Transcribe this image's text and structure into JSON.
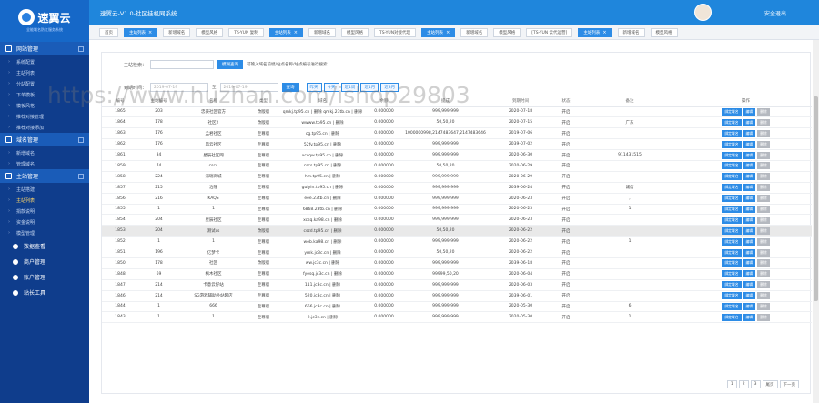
{
  "app": {
    "brand": "速翼云",
    "slogan": "全能域名防红服务系统",
    "title": "速翼云-V1.0-社区挂机网系统",
    "logout": "安全退出"
  },
  "sidebar": {
    "sections": [
      {
        "label": "网站管理",
        "items": [
          "系统配置",
          "主站列表",
          "分站配置",
          "下单模板",
          "模板风格",
          "推荐对接管理",
          "推荐对接添加"
        ]
      },
      {
        "label": "域名管理",
        "items": [
          "新增域名",
          "管理域名"
        ]
      },
      {
        "label": "主站管理",
        "items": [
          "主站搭建",
          "主站列表",
          "捐款说明",
          "资金说明",
          "模型管理"
        ],
        "active": "主站列表"
      }
    ],
    "plain": [
      "数据查看",
      "商户管理",
      "账户管理",
      "站长工具"
    ]
  },
  "tabs": [
    {
      "label": "首页"
    },
    {
      "label": "主站列表",
      "on": true
    },
    {
      "label": "新增域名"
    },
    {
      "label": "模型风格"
    },
    {
      "label": "TS-YUN 复制"
    },
    {
      "label": "主站列表",
      "on": true
    },
    {
      "label": "新增域名"
    },
    {
      "label": "模型风格"
    },
    {
      "label": "TS-YUN对接代理"
    },
    {
      "label": "主站列表",
      "on": true
    },
    {
      "label": "新增域名"
    },
    {
      "label": "模型风格"
    },
    {
      "label": "[TS-YUN 云代运营]"
    },
    {
      "label": "主站列表",
      "on": true
    },
    {
      "label": "新增域名"
    },
    {
      "label": "模型风格"
    }
  ],
  "filters": {
    "search_label": "主站检索：",
    "search_btn": "模糊查询",
    "hint": "可输入域名前缀/站点名称/站点编号进行搜索",
    "date_label": "到期时间：",
    "date_from": "2019-07-19",
    "to": "至",
    "date_to": "2019-07-19",
    "query_btn": "查询",
    "quick": [
      "昨天",
      "今天",
      "近1周",
      "近1月",
      "近3月"
    ]
  },
  "table": {
    "headers": [
      "编号",
      "主站编号",
      "名称",
      "类型",
      "域名",
      "余额",
      "提成",
      "到期时间",
      "状态",
      "备注",
      "操作"
    ],
    "actions": [
      "绑定域名",
      "编辑",
      "删除"
    ],
    "rows": [
      [
        "1865",
        "203",
        "忠豪社区官方",
        "改版版",
        "qmkj.tp95.cn | 删除 qmkj.23tb.cn | 删除",
        "0.000000",
        "999,999,999",
        "2020-07-18",
        "开启",
        ""
      ],
      [
        "1864",
        "178",
        "社区2",
        "改版版",
        "wwww.tp95.cn | 删除",
        "0.000000",
        "50,50,20",
        "2020-07-15",
        "开启",
        "广东"
      ],
      [
        "1863",
        "176",
        "孟君社区",
        "至尊版",
        "cg.tp95.cn | 删除",
        "0.000000",
        "1000000998,2147483647,2147483646",
        "2019-07-06",
        "开启",
        ""
      ],
      [
        "1862",
        "176",
        "风云社区",
        "至尊版",
        "52fy.tp95.cn | 删除",
        "0.000000",
        "999,999,999",
        "2039-07-02",
        "开启",
        ""
      ],
      [
        "1861",
        "34",
        "星辰社区网",
        "至尊版",
        "xcsqw.tp95.cn | 删除",
        "0.000000",
        "999,999,999",
        "2020-06-30",
        "开启",
        "911431515"
      ],
      [
        "1859",
        "74",
        "cscs",
        "至尊版",
        "cscs.tp95.cn | 删除",
        "0.000000",
        "50,50,20",
        "2020-06-29",
        "开启",
        ""
      ],
      [
        "1858",
        "224",
        "海瑞商城",
        "至尊版",
        "hm.tp95.cn | 删除",
        "0.000000",
        "999,999,999",
        "2020-06-29",
        "开启",
        ""
      ],
      [
        "1857",
        "215",
        "治隆",
        "至尊版",
        "guiyin.tp95.cn | 删除",
        "0.000000",
        "999,999,999",
        "2039-06-24",
        "开启",
        "诚信"
      ],
      [
        "1856",
        "216",
        "KAQS",
        "至尊版",
        "eee.23tb.cn | 删除",
        "0.000000",
        "999,999,999",
        "2020-06-23",
        "开启",
        ","
      ],
      [
        "1855",
        "1",
        "1",
        "至尊版",
        "6868.23tb.cn | 删除",
        "0.000000",
        "999,999,999",
        "2020-06-23",
        "开启",
        "1"
      ],
      [
        "1854",
        "204",
        "星辰社区",
        "至尊版",
        "xcsq.ka98.cn | 删除",
        "0.000000",
        "999,999,999",
        "2020-06-23",
        "开启",
        ""
      ],
      [
        "1853",
        "204",
        "测试cs",
        "改版版",
        "cszd.tp95.cn | 删除",
        "0.000000",
        "50,50,20",
        "2020-06-22",
        "开启",
        ""
      ],
      [
        "1852",
        "1",
        "1",
        "至尊版",
        "web.ka98.cn | 删除",
        "0.000000",
        "999,999,999",
        "2020-06-22",
        "开启",
        "1"
      ],
      [
        "1851",
        "196",
        "亿梦卡",
        "至尊版",
        "ymk.jc3c.cn | 删除",
        "0.000000",
        "50,50,20",
        "2020-06-22",
        "开启",
        ""
      ],
      [
        "1850",
        "178",
        "社区",
        "改版版",
        "ww.jc3c.cn | 删除",
        "0.000000",
        "999,999,999",
        "2039-06-18",
        "开启",
        ""
      ],
      [
        "1848",
        "69",
        "枫木社区",
        "至尊版",
        "fyesq.jc3c.cn | 删除",
        "0.000000",
        "99999,50,20",
        "2020-06-04",
        "开启",
        ""
      ],
      [
        "1847",
        "214",
        "卡意云好站",
        "至尊版",
        "111.jc3c.cn | 删除",
        "0.000000",
        "999,999,999",
        "2020-06-03",
        "开启",
        ""
      ],
      [
        "1846",
        "214",
        "SG游戏辅助外站网店",
        "至尊版",
        "520.jc3c.cn | 删除",
        "0.000000",
        "999,999,999",
        "2039-06-01",
        "开启",
        ""
      ],
      [
        "1844",
        "1",
        "666",
        "至尊版",
        "666.jc3c.cn | 删除",
        "0.000000",
        "999,999,999",
        "2020-05-30",
        "开启",
        "6"
      ],
      [
        "1843",
        "1",
        "1",
        "至尊版",
        "2.jc3c.cn | 删除",
        "0.000000",
        "999,999,999",
        "2020-05-30",
        "开启",
        "1"
      ]
    ],
    "highlight_index": 11
  },
  "pager": [
    "1",
    "2",
    "3",
    "尾页",
    "下一页"
  ],
  "watermark": "https://www.huzhan.com/ishop29803"
}
